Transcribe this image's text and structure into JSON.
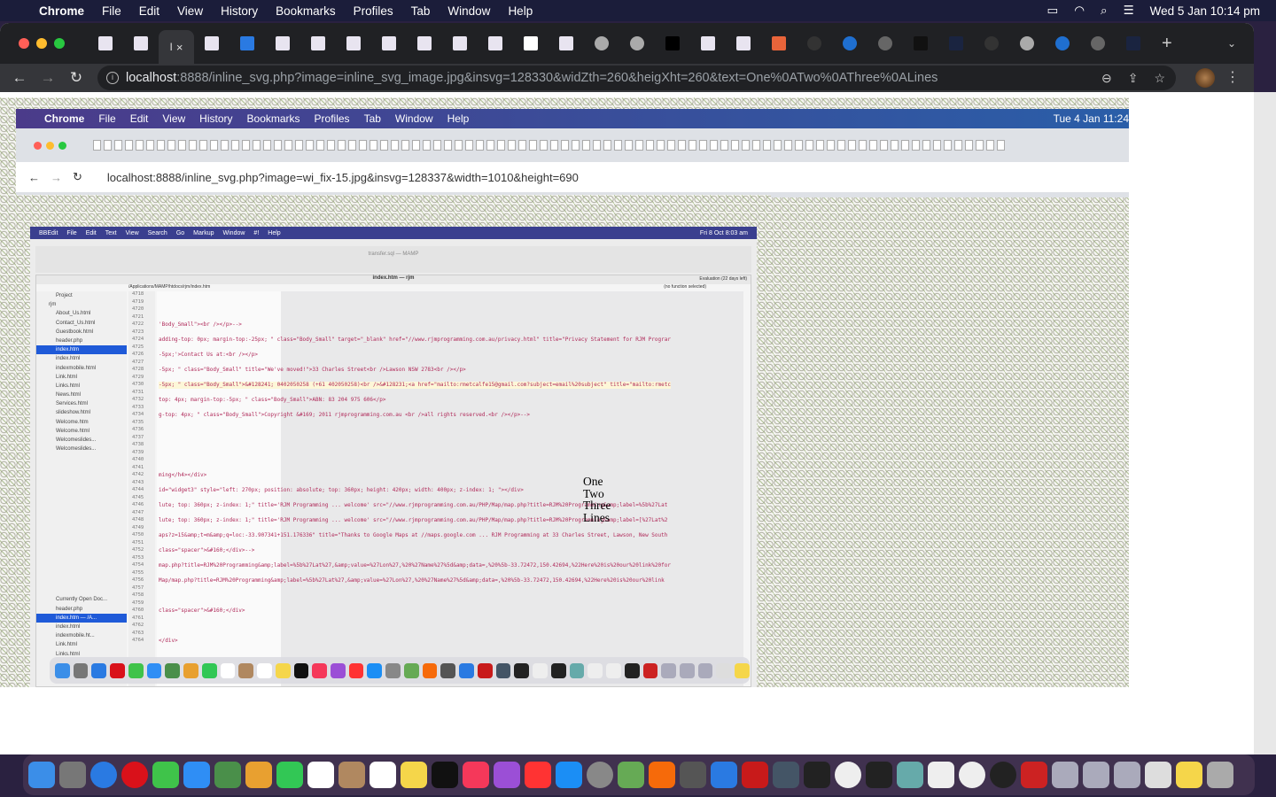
{
  "menubar": {
    "app": "Chrome",
    "items": [
      "File",
      "Edit",
      "View",
      "History",
      "Bookmarks",
      "Profiles",
      "Tab",
      "Window",
      "Help"
    ],
    "clock": "Wed 5 Jan  10:14 pm"
  },
  "tabs": {
    "active_index": 2,
    "active_label": "I",
    "favicons": [
      "rjm-page",
      "rjm-page",
      "active",
      "rjm-page",
      "ie",
      "rjm-page",
      "rjm-page",
      "rjm-page",
      "rjm-page",
      "rjm-page",
      "rjm-page",
      "rjm-page",
      "blank",
      "rjm-page",
      "github",
      "github",
      "cap",
      "rjm-page",
      "rjm-page",
      "m-orange",
      "at",
      "blue-circle",
      "chrome",
      "ooo",
      "s",
      "at",
      "github",
      "blue-circle",
      "chrome",
      "s"
    ],
    "new_tab": "+"
  },
  "address": {
    "host": "localhost",
    "path": ":8888/inline_svg.php?image=inline_svg_image.jpg&insvg=128330&widZth=260&heigXht=260&text=One%0ATwo%0AThree%0ALines"
  },
  "inner": {
    "menubar": {
      "app": "Chrome",
      "items": [
        "File",
        "Edit",
        "View",
        "History",
        "Bookmarks",
        "Profiles",
        "Tab",
        "Window",
        "Help"
      ],
      "clock": "Tue 4 Jan  11:24"
    },
    "address": "localhost:8888/inline_svg.php?image=wi_fix-15.jpg&insvg=128337&width=1010&height=690",
    "bbedit": {
      "menubar": [
        "BBEdit",
        "File",
        "Edit",
        "Text",
        "View",
        "Search",
        "Go",
        "Markup",
        "Window",
        "#!",
        "Help"
      ],
      "clock": "Fri 8 Oct  8:03 am",
      "back_title": "transfer.sql — MAMP",
      "title": "index.htm — rjm",
      "evaluation": "Evaluation (22 days left)",
      "path": "/Applications/MAMP/htdocs/rjm/index.htm",
      "function": "(no function selected)",
      "project_label": "Project",
      "files": [
        "rjm",
        "About_Us.html",
        "Contact_Us.html",
        "Guestbook.html",
        "header.php",
        "index.htm",
        "index.html",
        "indexmobile.html",
        "Link.html",
        "Links.html",
        "News.html",
        "Services.html",
        "slideshow.html",
        "Welcome.htm",
        "Welcome.html",
        "Welcomeslides...",
        "Welcomeslides..."
      ],
      "selected_file": "index.htm",
      "open_docs_label": "Currently Open Doc...",
      "open_docs": [
        "header.php",
        "index.htm — /A...",
        "index.html",
        "indexmobile.ht...",
        "Link.html",
        "Links.html"
      ],
      "first_line": 4718,
      "last_line": 4764,
      "code": [
        {
          "line": 4722,
          "text": "'Body_Small\"><br /></p>-->"
        },
        {
          "line": 4724,
          "text": "adding-top: 0px; margin-top:-25px; \" class=\"Body_Small\" target=\"_blank\" href=\"//www.rjmprogramming.com.au/privacy.html\" title=\"Privacy Statement for RJM Prograr"
        },
        {
          "line": 4726,
          "text": "-5px;'>Contact Us at:<br /></p>"
        },
        {
          "line": 4728,
          "text": "-5px; \" class=\"Body_Small\" title=\"We've moved!\">33 Charles Street<br />Lawson NSW 2783<br /></p>"
        },
        {
          "line": 4730,
          "text": "-5px; \" class=\"Body_Small\">&#128241; 0402050258 (+61 402050258)<br />&#128231;<a href=\"mailto:rmetcalfe15@gmail.com?subject=email%20subject\" title=\"mailto:rmetc"
        },
        {
          "line": 4732,
          "text": "top: 4px; margin-top:-5px; \" class=\"Body_Small\">ABN: 83 204 975 606</p>"
        },
        {
          "line": 4734,
          "text": "g-top: 4px; \" class=\"Body_Small\">Copyright &#169; 2011 rjmprogramming.com.au <br />all rights reserved.<br /></p>-->"
        },
        {
          "line": 4742,
          "text": "ming</h4></div>"
        },
        {
          "line": 4744,
          "text": "id=\"widget3\" style=\"left: 270px; position: absolute; top: 360px; height: 420px; width: 400px; z-index: 1; \"></div>"
        },
        {
          "line": 4746,
          "text": "lute; top: 360px; z-index: 1;\" title='RJM Programming ... welcome' src=\"//www.rjmprogramming.com.au/PHP/Map/map.php?title=RJM%20Programming&amp;label=%5b%27Lat"
        },
        {
          "line": 4748,
          "text": "lute; top: 360px; z-index: 1;\" title='RJM Programming ... welcome' src=\"//www.rjmprogramming.com.au/PHP/Map/map.php?title=RJM%20Programming&amp;label=[%27Lat%2"
        },
        {
          "line": 4750,
          "text": "aps?z=15&amp;t=m&amp;q=loc:-33.907341+151.176336\" title=\"Thanks to Google Maps at //maps.google.com ... RJM Programming at 33 Charles Street, Lawson, New South"
        },
        {
          "line": 4752,
          "text": "class=\"spacer\">&#160;</div>-->"
        },
        {
          "line": 4754,
          "text": "map.php?title=RJM%20Programming&amp;label=%5b%27Lat%27,&amp;value=%27Lon%27,%20%27Name%27%5d&amp;data=,%20%5b-33.72472,150.42694,%22Here%20is%20our%20link%20for"
        },
        {
          "line": 4756,
          "text": "Map/map.php?title=RJM%20Programming&amp;label=%5b%27Lat%27,&amp;value=%27Lon%27,%20%27Name%27%5d&amp;data=,%20%5b-33.72472,150.42694,%22Here%20is%20our%20link"
        },
        {
          "line": 4760,
          "text": "class=\"spacer\">&#160;</div>"
        },
        {
          "line": 4764,
          "text": "</div>"
        }
      ]
    },
    "overlay_text": "One\nTwo\nThree\nLines"
  },
  "dock": {
    "apps": [
      "finder",
      "launchpad",
      "safari",
      "opera",
      "messages",
      "mail",
      "maps",
      "photos",
      "facetime",
      "calendar",
      "contacts",
      "reminders",
      "notes",
      "tv",
      "music",
      "podcasts",
      "news",
      "app-store",
      "system-preferences",
      "game",
      "firefox",
      "calculator",
      "xcode",
      "filezilla",
      "bbedit",
      "terminal",
      "github",
      "intellij",
      "preview",
      "document",
      "chrome",
      "quicktime",
      "acrobat",
      "folder",
      "folder",
      "folder",
      "folder",
      "folder",
      "trash"
    ],
    "colors": [
      "#3b8ee8",
      "#777",
      "#2a7ae2",
      "#d9111a",
      "#3fc34a",
      "#2f8ef5",
      "#4a8f4a",
      "#e8a030",
      "#32c755",
      "#fff",
      "#b08860",
      "#fff",
      "#f5d64a",
      "#111",
      "#f5385a",
      "#9b4fd6",
      "#f33",
      "#1b8ef5",
      "#888",
      "#6a5",
      "#f66a0a",
      "#555",
      "#2a7ae2",
      "#c81a1a",
      "#456",
      "#222",
      "#eee",
      "#222",
      "#6aa",
      "#eee",
      "#eee",
      "#222",
      "#c22",
      "#aab",
      "#aab",
      "#aab",
      "#ddd",
      "#f5d64a",
      "#aaa"
    ]
  },
  "colors": {
    "menubar": "#1b1d3a",
    "tabstrip": "#202124",
    "toolbar": "#35363a"
  }
}
